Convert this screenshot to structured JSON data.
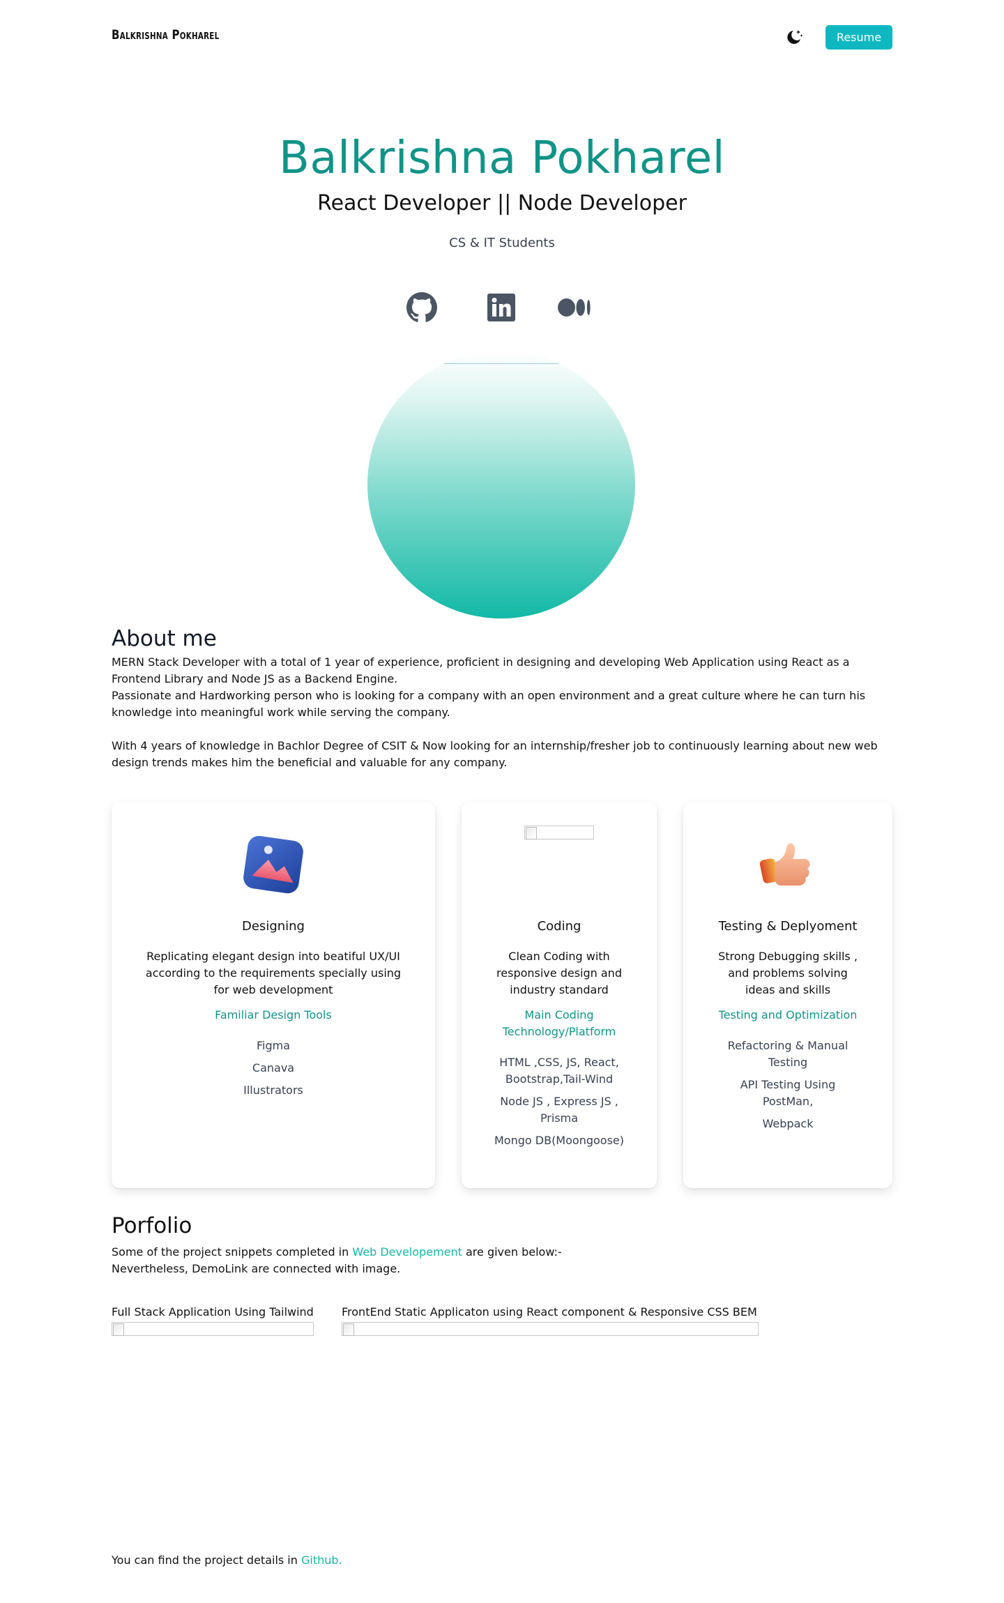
{
  "nav": {
    "brand": "Balkrishna Pokharel",
    "theme_toggle_icon": "moon-stars-icon",
    "resume_label": "Resume",
    "accent_color": "#0fb8c1"
  },
  "hero": {
    "name": "Balkrishna Pokharel",
    "role": "React Developer || Node Developer",
    "subtitle": "CS & IT Students",
    "name_color": "#109488",
    "social": [
      {
        "icon": "github-icon"
      },
      {
        "icon": "linkedin-icon"
      },
      {
        "icon": "medium-icon"
      }
    ]
  },
  "about": {
    "title": "About me",
    "para1_line1": "MERN Stack Developer with a total of 1 year of experience, proficient in designing and developing Web Application using React as a",
    "para1_line2": "Frontend Library and Node JS as a Backend Engine.",
    "para1_line3": "Passionate and Hardworking person who is looking for a company with an open environment and a great culture where he can turn his",
    "para1_line4": "knowledge into meaningful work while serving the company.",
    "para2_line1": "With 4 years of knowledge in Bachlor Degree of CSIT & Now looking for an internship/fresher job to continuously learning about new web",
    "para2_line2": "design trends makes him the beneficial and valuable for any company."
  },
  "cards": [
    {
      "icon": "image-3d-icon",
      "title": "Designing",
      "desc": [
        "Replicating elegant design into beatiful UX/UI",
        "according to the requirements specially using",
        "for web development"
      ],
      "sub": [
        "Familiar Design Tools"
      ],
      "items": [
        [
          "Figma"
        ],
        [
          "Canava"
        ],
        [
          "Illustrators"
        ]
      ]
    },
    {
      "icon": "broken-image-icon",
      "title": "Coding",
      "desc": [
        "Clean Coding with",
        "responsive design and",
        "industry standard"
      ],
      "sub": [
        "Main Coding",
        "Technology/Platform"
      ],
      "items": [
        [
          "HTML ,CSS, JS, React,",
          "Bootstrap,Tail-Wind"
        ],
        [
          "Node JS , Express JS ,",
          "Prisma"
        ],
        [
          "Mongo DB(Moongoose)"
        ]
      ]
    },
    {
      "icon": "thumbs-up-3d-icon",
      "title": "Testing & Deplyoment",
      "desc": [
        "Strong Debugging skills ,",
        "and problems solving",
        "ideas and skills"
      ],
      "sub": [
        "Testing and Optimization"
      ],
      "items": [
        [
          "Refactoring & Manual",
          "Testing"
        ],
        [
          "API Testing Using",
          "PostMan,"
        ],
        [
          "Webpack"
        ]
      ]
    }
  ],
  "portfolio": {
    "title": "Porfolio",
    "intro_before": "Some of the project snippets completed in ",
    "intro_link": "Web Developement",
    "intro_after": " are given below:-",
    "intro_line2": "Nevertheless, DemoLink are connected with image.",
    "projects": [
      {
        "label": "Full Stack Application Using Tailwind"
      },
      {
        "label": "FrontEnd Static Applicaton using React component & Responsive CSS BEM"
      }
    ],
    "footer_before": "You can find the project details in ",
    "footer_link": "Github."
  }
}
